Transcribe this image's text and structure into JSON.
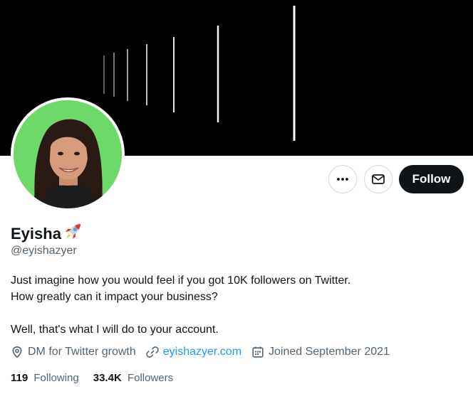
{
  "profile": {
    "name": "Eyisha",
    "name_emoji": "rocket-icon",
    "handle": "@eyishazyer",
    "bio_lines": [
      "Just imagine how you would feel if you got 10K followers on Twitter.",
      "How greatly can it impact your business?",
      "",
      "Well, that's what I will do to your account."
    ],
    "location": "DM for Twitter growth",
    "website": "eyishazyer.com",
    "joined": "Joined September 2021",
    "following_count": "119",
    "following_label": "Following",
    "followers_count": "33.4K",
    "followers_label": "Followers"
  },
  "actions": {
    "more_icon": "more-horizontal-icon",
    "message_icon": "envelope-icon",
    "follow_label": "Follow"
  },
  "colors": {
    "banner": "#000000",
    "avatar_background": "#6fd86a",
    "link": "#1d9bf0",
    "follow_button": "#0f1419",
    "secondary_text": "#536471"
  }
}
